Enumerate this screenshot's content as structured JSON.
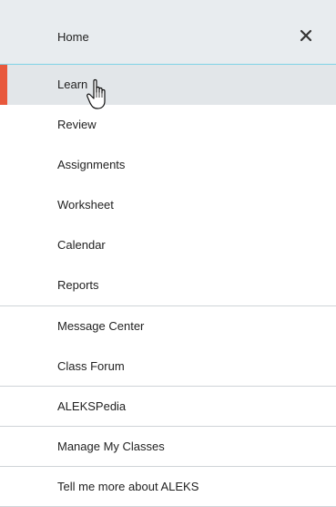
{
  "menu": {
    "header_label": "Home",
    "close_icon": "close-icon",
    "items": [
      {
        "label": "Learn"
      },
      {
        "label": "Review"
      },
      {
        "label": "Assignments"
      },
      {
        "label": "Worksheet"
      },
      {
        "label": "Calendar"
      },
      {
        "label": "Reports"
      },
      {
        "label": "Message Center"
      },
      {
        "label": "Class Forum"
      },
      {
        "label": "ALEKSPedia"
      },
      {
        "label": "Manage My Classes"
      },
      {
        "label": "Tell me more about ALEKS"
      }
    ],
    "active_item": "Learn",
    "accent_color": "#e8583c",
    "header_border_color": "#7fd3e6"
  }
}
